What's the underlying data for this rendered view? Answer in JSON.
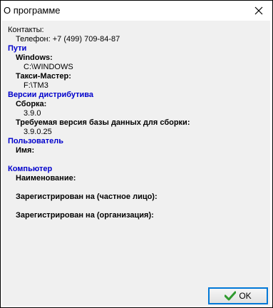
{
  "window": {
    "title": "О программе"
  },
  "contacts": {
    "label": "Контакты:",
    "phone": "Телефон: +7 (499) 709-84-87"
  },
  "paths": {
    "header": "Пути",
    "windows_label": "Windows:",
    "windows_value": "C:\\WINDOWS",
    "taxi_label": "Такси-Мастер:",
    "taxi_value": "F:\\TM3"
  },
  "versions": {
    "header": "Версии дистрибутива",
    "build_label": "Сборка:",
    "build_value": "3.9.0",
    "db_label": "Требуемая версия базы данных для сборки:",
    "db_value": "3.9.0.25"
  },
  "user": {
    "header": "Пользователь",
    "name_label": "Имя:"
  },
  "computer": {
    "header": "Компьютер",
    "name_label": "Наименование:",
    "reg_person_label": "Зарегистрирован на (частное лицо):",
    "reg_org_label": "Зарегистрирован на (организация):"
  },
  "buttons": {
    "ok_label": "OK"
  },
  "colors": {
    "section_header": "#0000cc",
    "client_bg": "#f0f0f0",
    "ok_border": "#0078d7"
  },
  "icons": {
    "close": "close-icon",
    "ok": "checkmark-icon"
  }
}
